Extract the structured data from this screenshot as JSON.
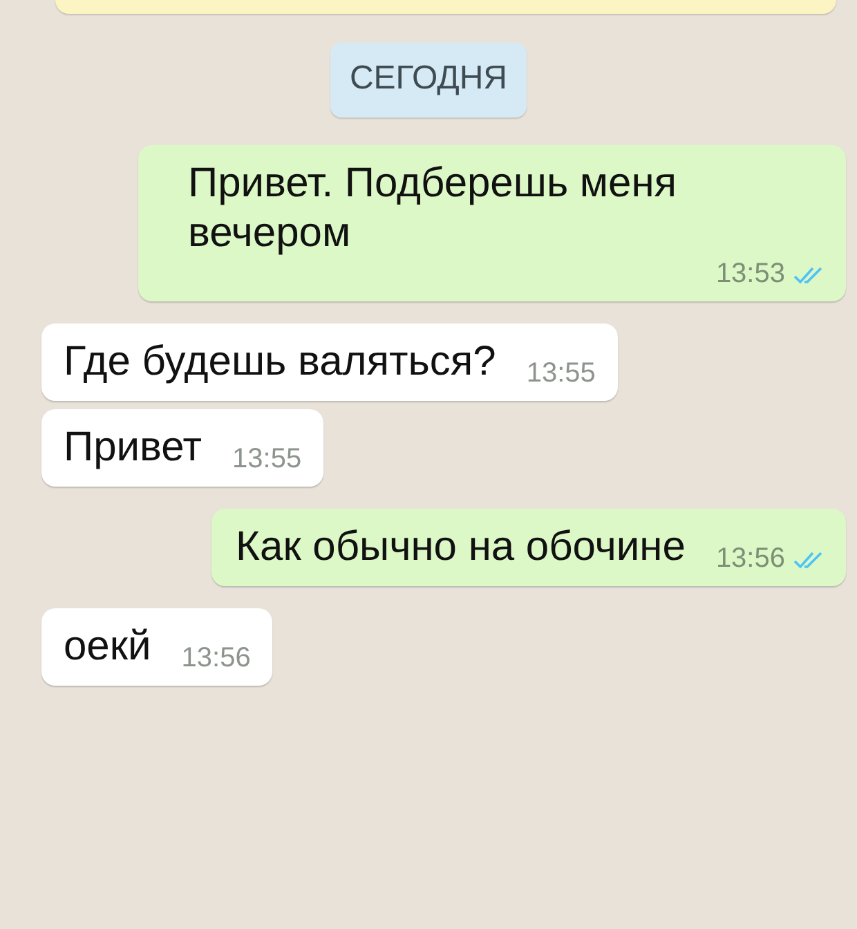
{
  "date_chip": "СЕГОДНЯ",
  "messages": [
    {
      "kind": "out",
      "text": "Привет. Подберешь меня вечером",
      "time": "13:53",
      "read": true
    },
    {
      "kind": "in",
      "text": "Где будешь валяться?",
      "time": "13:55"
    },
    {
      "kind": "in",
      "text": "Привет",
      "time": "13:55"
    },
    {
      "kind": "out",
      "text": "Как обычно на обочине",
      "time": "13:56",
      "read": true
    },
    {
      "kind": "in",
      "text": "оекй",
      "time": "13:56"
    }
  ]
}
